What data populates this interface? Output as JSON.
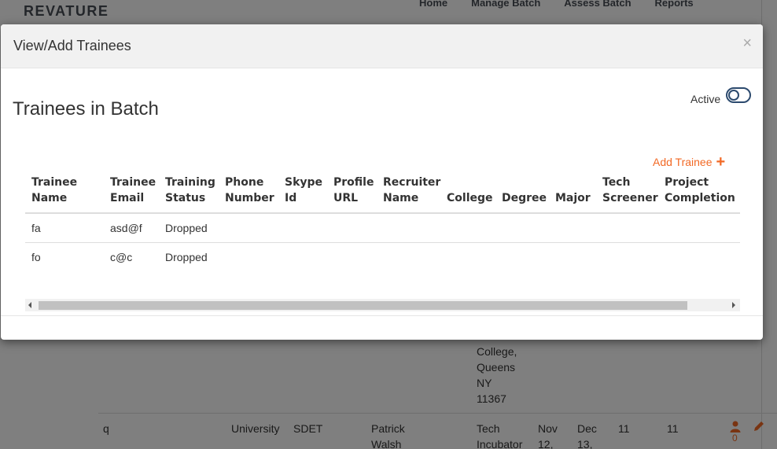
{
  "background": {
    "logo_text": "REVATURE",
    "nav": [
      "Home",
      "Manage Batch",
      "Assess Batch",
      "Reports"
    ],
    "rows": {
      "college_fragment": [
        "College,",
        "Queens",
        "NY",
        "11367"
      ],
      "row_q": {
        "name": "q",
        "school_type": "University",
        "skill": "SDET",
        "trainer": [
          "Patrick",
          "Walsh"
        ],
        "location": [
          "Tech",
          "Incubator"
        ],
        "start_date": [
          "Nov",
          "12,"
        ],
        "end_date": [
          "Dec",
          "13,"
        ],
        "col_a": "11",
        "col_b": "11",
        "trainee_count": "0"
      }
    }
  },
  "modal": {
    "title": "View/Add Trainees",
    "close_label": "×",
    "section_title": "Trainees in Batch",
    "active_label": "Active",
    "active_toggle_on": false,
    "add_trainee_label": "Add Trainee",
    "table": {
      "headers": [
        [
          "Trainee",
          "Name"
        ],
        [
          "Trainee",
          "Email"
        ],
        [
          "Training",
          "Status"
        ],
        [
          "Phone",
          "Number"
        ],
        [
          "Skype",
          "Id"
        ],
        [
          "Profile",
          "URL"
        ],
        [
          "Recruiter",
          "Name"
        ],
        [
          "",
          "College"
        ],
        [
          "",
          "Degree"
        ],
        [
          "",
          "Major"
        ],
        [
          "Tech",
          "Screener"
        ],
        [
          "Project",
          "Completion"
        ]
      ],
      "rows": [
        [
          "fa",
          "asd@f",
          "Dropped",
          "",
          "",
          "",
          "",
          "",
          "",
          "",
          "",
          ""
        ],
        [
          "fo",
          "c@c",
          "Dropped",
          "",
          "",
          "",
          "",
          "",
          "",
          "",
          "",
          ""
        ]
      ]
    }
  },
  "colors": {
    "accent": "#f26925",
    "toggle_border": "#2c4a6e",
    "overlay": "rgba(0,0,0,0.5)"
  }
}
